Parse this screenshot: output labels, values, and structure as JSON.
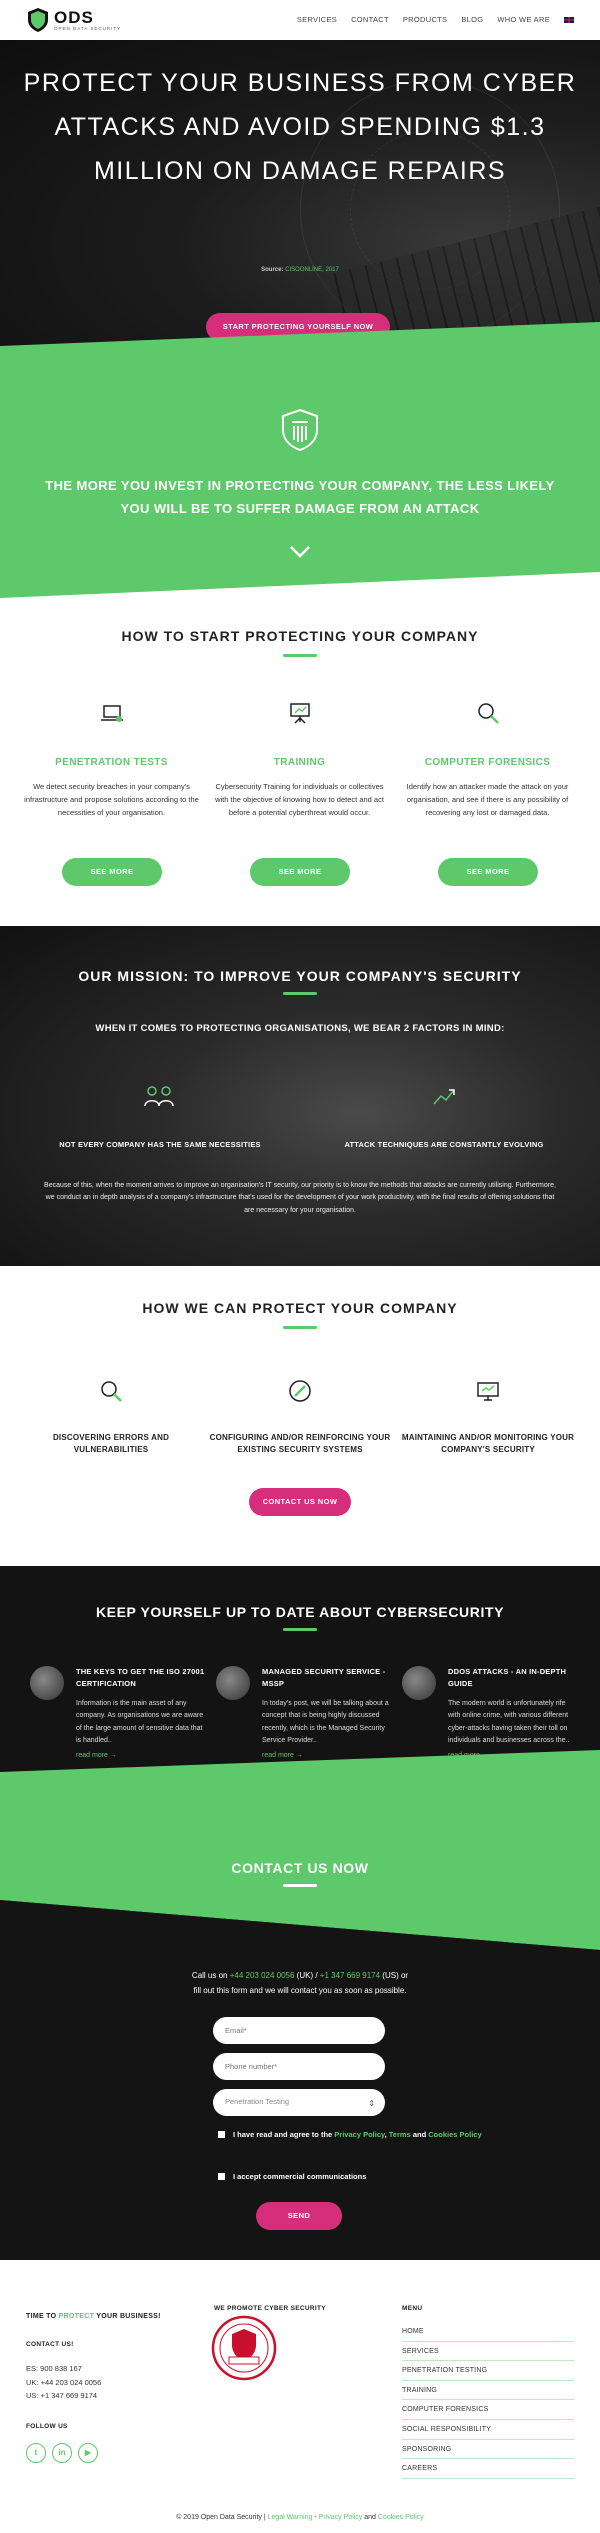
{
  "header": {
    "logo_text": "ODS",
    "logo_subtext": "OPEN DATA SECURITY",
    "nav": [
      "SERVICES",
      "CONTACT",
      "PRODUCTS",
      "BLOG",
      "WHO WE ARE"
    ]
  },
  "hero": {
    "title": "PROTECT YOUR BUSINESS FROM CYBER ATTACKS AND AVOID SPENDING $1.3 MILLION ON DAMAGE REPAIRS",
    "source_label": "Source:",
    "source_link": "CISOONLINE, 2017",
    "cta": "START PROTECTING YOURSELF NOW"
  },
  "green_band": {
    "text": "THE MORE YOU INVEST IN PROTECTING YOUR COMPANY, THE LESS LIKELY YOU WILL BE TO SUFFER DAMAGE FROM AN ATTACK"
  },
  "services": {
    "title": "HOW TO START PROTECTING YOUR COMPANY",
    "items": [
      {
        "title": "PENETRATION TESTS",
        "text": "We detect security breaches in your company's infrastructure and propose solutions according to the necessities of your organisation.",
        "button": "SEE MORE"
      },
      {
        "title": "TRAINING",
        "text": "Cybersecurity Training for individuals or collectives with the objective of knowing how to detect and act before a potential cyberthreat would occur.",
        "button": "SEE MORE"
      },
      {
        "title": "COMPUTER FORENSICS",
        "text": "Identify how an attacker made the attack on your organisation, and see if there is any possibility of recovering any lost or damaged data.",
        "button": "SEE MORE"
      }
    ]
  },
  "mission": {
    "title": "OUR MISSION: TO IMPROVE YOUR COMPANY'S SECURITY",
    "subtitle": "WHEN IT COMES TO PROTECTING ORGANISATIONS, WE BEAR 2 FACTORS IN MIND:",
    "factor_1": "NOT EVERY COMPANY HAS THE SAME NECESSITIES",
    "factor_2": "ATTACK TECHNIQUES ARE CONSTANTLY EVOLVING",
    "description": "Because of this, when the moment arrives to improve an organisation's IT security, our priority is to know the methods that attacks are currently utilising. Furthermore, we conduct an in depth analysis of a company's infrastructure that's used for the development of your work productivity, with the final results of offering solutions that are necessary for your organisation."
  },
  "protect": {
    "title": "HOW WE CAN PROTECT YOUR COMPANY",
    "items": [
      "DISCOVERING ERRORS AND VULNERABILITIES",
      "CONFIGURING AND/OR REINFORCING YOUR EXISTING SECURITY SYSTEMS",
      "MAINTAINING AND/OR MONITORING YOUR COMPANY'S SECURITY"
    ],
    "cta": "CONTACT US NOW"
  },
  "blog": {
    "title": "KEEP YOURSELF UP TO DATE ABOUT CYBERSECURITY",
    "posts": [
      {
        "title": "THE KEYS TO GET THE ISO 27001 CERTIFICATION",
        "excerpt": "Information is the main asset of any company. As organisations we are aware of the large amount of sensitive data that is handled..",
        "link": "read more →"
      },
      {
        "title": "MANAGED SECURITY SERVICE - MSSP",
        "excerpt": "In today's post, we will be talking about a concept that is being highly discussed recently, which is the Managed Security Service Provider..",
        "link": "read more →"
      },
      {
        "title": "DDOS ATTACKS - AN IN-DEPTH GUIDE",
        "excerpt": "The modern world is unfortunately rife with online crime, with various different cyber-attacks having taken their toll on individuals and businesses across the..",
        "link": "read more →"
      }
    ]
  },
  "contact": {
    "title": "CONTACT US NOW",
    "line1_prefix": "Call us on ",
    "phone_uk": "+44 203 024 0056",
    "uk_label": " (UK) / ",
    "phone_us": "+1 347 669 9174",
    "us_label": " (US) or",
    "line2": "fill out this form and we will contact you as soon as possible.",
    "email_placeholder": "Email*",
    "phone_placeholder": "Phone number*",
    "select_value": "Penetration Testing",
    "consent_prefix": "I have read and agree to the ",
    "privacy_policy": "Privacy Policy",
    "terms_sep": ", ",
    "terms": "Terms",
    "and": " and ",
    "cookies_policy": "Cookies Policy",
    "consent_2": "I accept commercial communications",
    "send": "SEND"
  },
  "footer": {
    "tagline_1": "TIME TO ",
    "tagline_2": "PROTECT",
    "tagline_3": " YOUR BUSINESS!",
    "contact_us": "CONTACT US!",
    "phones": [
      "ES: 900 838 167",
      "UK: +44 203 024 0056",
      "US: +1 347 669 9174"
    ],
    "follow_us": "FOLLOW US",
    "promote": "WE PROMOTE CYBER SECURITY",
    "menu_title": "MENU",
    "menu": [
      "HOME",
      "SERVICES",
      "PENETRATION TESTING",
      "TRAINING",
      "COMPUTER FORENSICS",
      "SOCIAL RESPONSIBILITY",
      "SPONSORING",
      "CAREERS"
    ]
  },
  "bottom": {
    "copyright": "© 2019 Open Data Security | ",
    "legal": "Legal Warning",
    "sep": " - ",
    "privacy": "Privacy Policy",
    "and": " and ",
    "cookies": "Cookies Policy"
  },
  "colors": {
    "accent": "#5ec96a",
    "pink": "#d62e7a",
    "dark": "#141414"
  }
}
